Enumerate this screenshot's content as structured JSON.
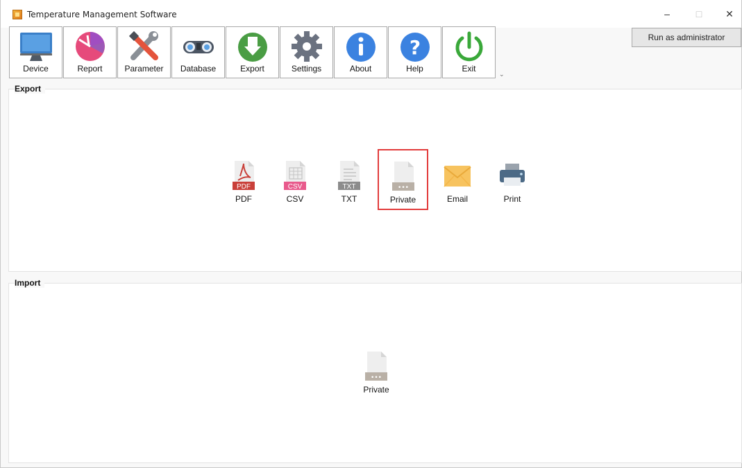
{
  "window": {
    "title": "Temperature Management Software",
    "controls": {
      "minimize": "–",
      "maximize": "□",
      "close": "✕"
    }
  },
  "toolbar": {
    "buttons": [
      {
        "label": "Device",
        "icon": "monitor-icon"
      },
      {
        "label": "Report",
        "icon": "pie-chart-icon"
      },
      {
        "label": "Parameter",
        "icon": "tools-icon"
      },
      {
        "label": "Database",
        "icon": "binoculars-icon"
      },
      {
        "label": "Export",
        "icon": "export-icon"
      },
      {
        "label": "Settings",
        "icon": "gear-icon"
      },
      {
        "label": "About",
        "icon": "info-icon"
      },
      {
        "label": "Help",
        "icon": "help-icon"
      },
      {
        "label": "Exit",
        "icon": "power-icon"
      }
    ],
    "overflow": "⌄",
    "run_as_admin": "Run as administrator"
  },
  "export": {
    "label": "Export",
    "items": [
      {
        "label": "PDF",
        "tag": "PDF",
        "icon": "pdf-file-icon"
      },
      {
        "label": "CSV",
        "tag": "CSV",
        "icon": "csv-file-icon"
      },
      {
        "label": "TXT",
        "tag": "TXT",
        "icon": "txt-file-icon"
      },
      {
        "label": "Private",
        "tag": "•••",
        "icon": "private-file-icon",
        "selected": true
      },
      {
        "label": "Email",
        "icon": "envelope-icon"
      },
      {
        "label": "Print",
        "icon": "printer-icon"
      }
    ]
  },
  "import": {
    "label": "Import",
    "items": [
      {
        "label": "Private",
        "tag": "•••",
        "icon": "private-file-icon"
      }
    ]
  },
  "colors": {
    "selection_border": "#e23b3b",
    "pdf": "#c9403a",
    "csv": "#e85a8c",
    "txt": "#8c8c8c",
    "private": "#b9b0a6"
  }
}
